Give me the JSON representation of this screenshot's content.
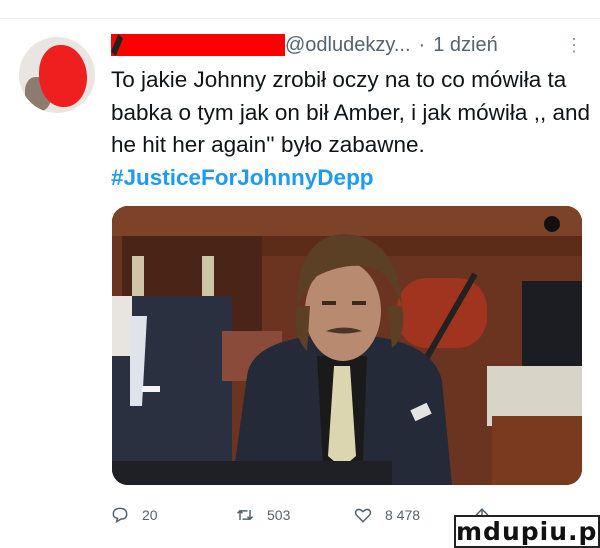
{
  "tweet": {
    "handle_suffix": "@odludekzy...",
    "separator": "·",
    "time": "1 dzień",
    "text": "To jakie Johnny zrobił oczy na to co mówiła ta babka o tym jak on bił Amber, i jak mówiła ,, and he hit her again'' było zabawne.",
    "hashtag": "#JusticeForJohnnyDepp"
  },
  "actions": {
    "reply_count": "20",
    "retweet_count": "503",
    "like_count": "8 478"
  },
  "watermark": "mdupiu.pl",
  "colors": {
    "hashtag": "#1d9bf0",
    "secondary": "#536471",
    "redaction": "#ff0000"
  }
}
